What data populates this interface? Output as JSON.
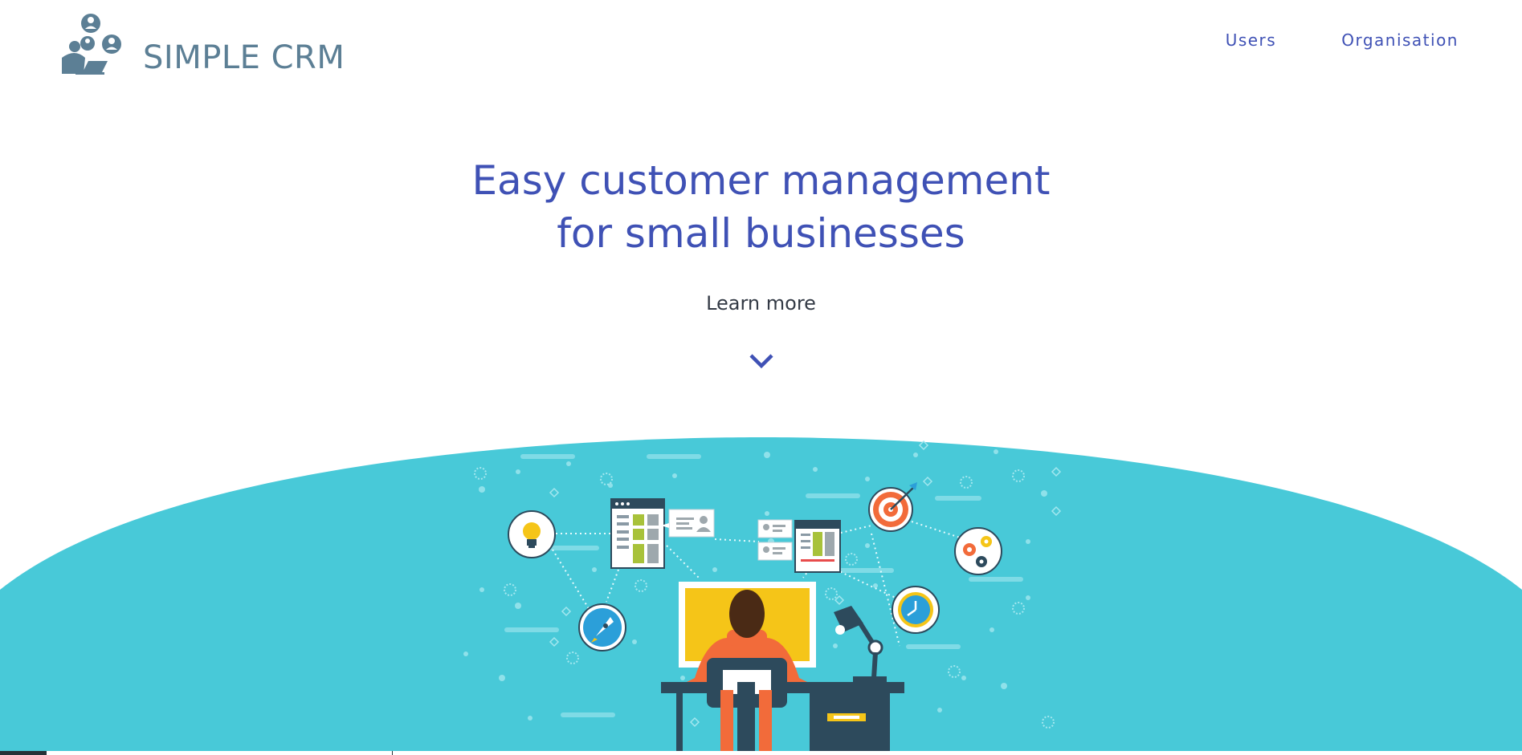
{
  "header": {
    "brand": "SIMPLE CRM",
    "logo_icon": "team-people-icon"
  },
  "nav": {
    "users": "Users",
    "organisation": "Organisation"
  },
  "hero": {
    "title_line1": "Easy customer management",
    "title_line2": "for small businesses",
    "learn_more": "Learn more",
    "chevron_icon": "chevron-down-icon"
  },
  "illustration": {
    "icons": [
      "lightbulb-icon",
      "rocket-icon",
      "target-icon",
      "gears-icon",
      "clock-icon",
      "desk-lamp-icon"
    ]
  },
  "colors": {
    "primary": "#3f51b5",
    "brand_text": "#5c7f95",
    "hero_bg": "#48c9d8",
    "text_dark": "#333a45"
  }
}
